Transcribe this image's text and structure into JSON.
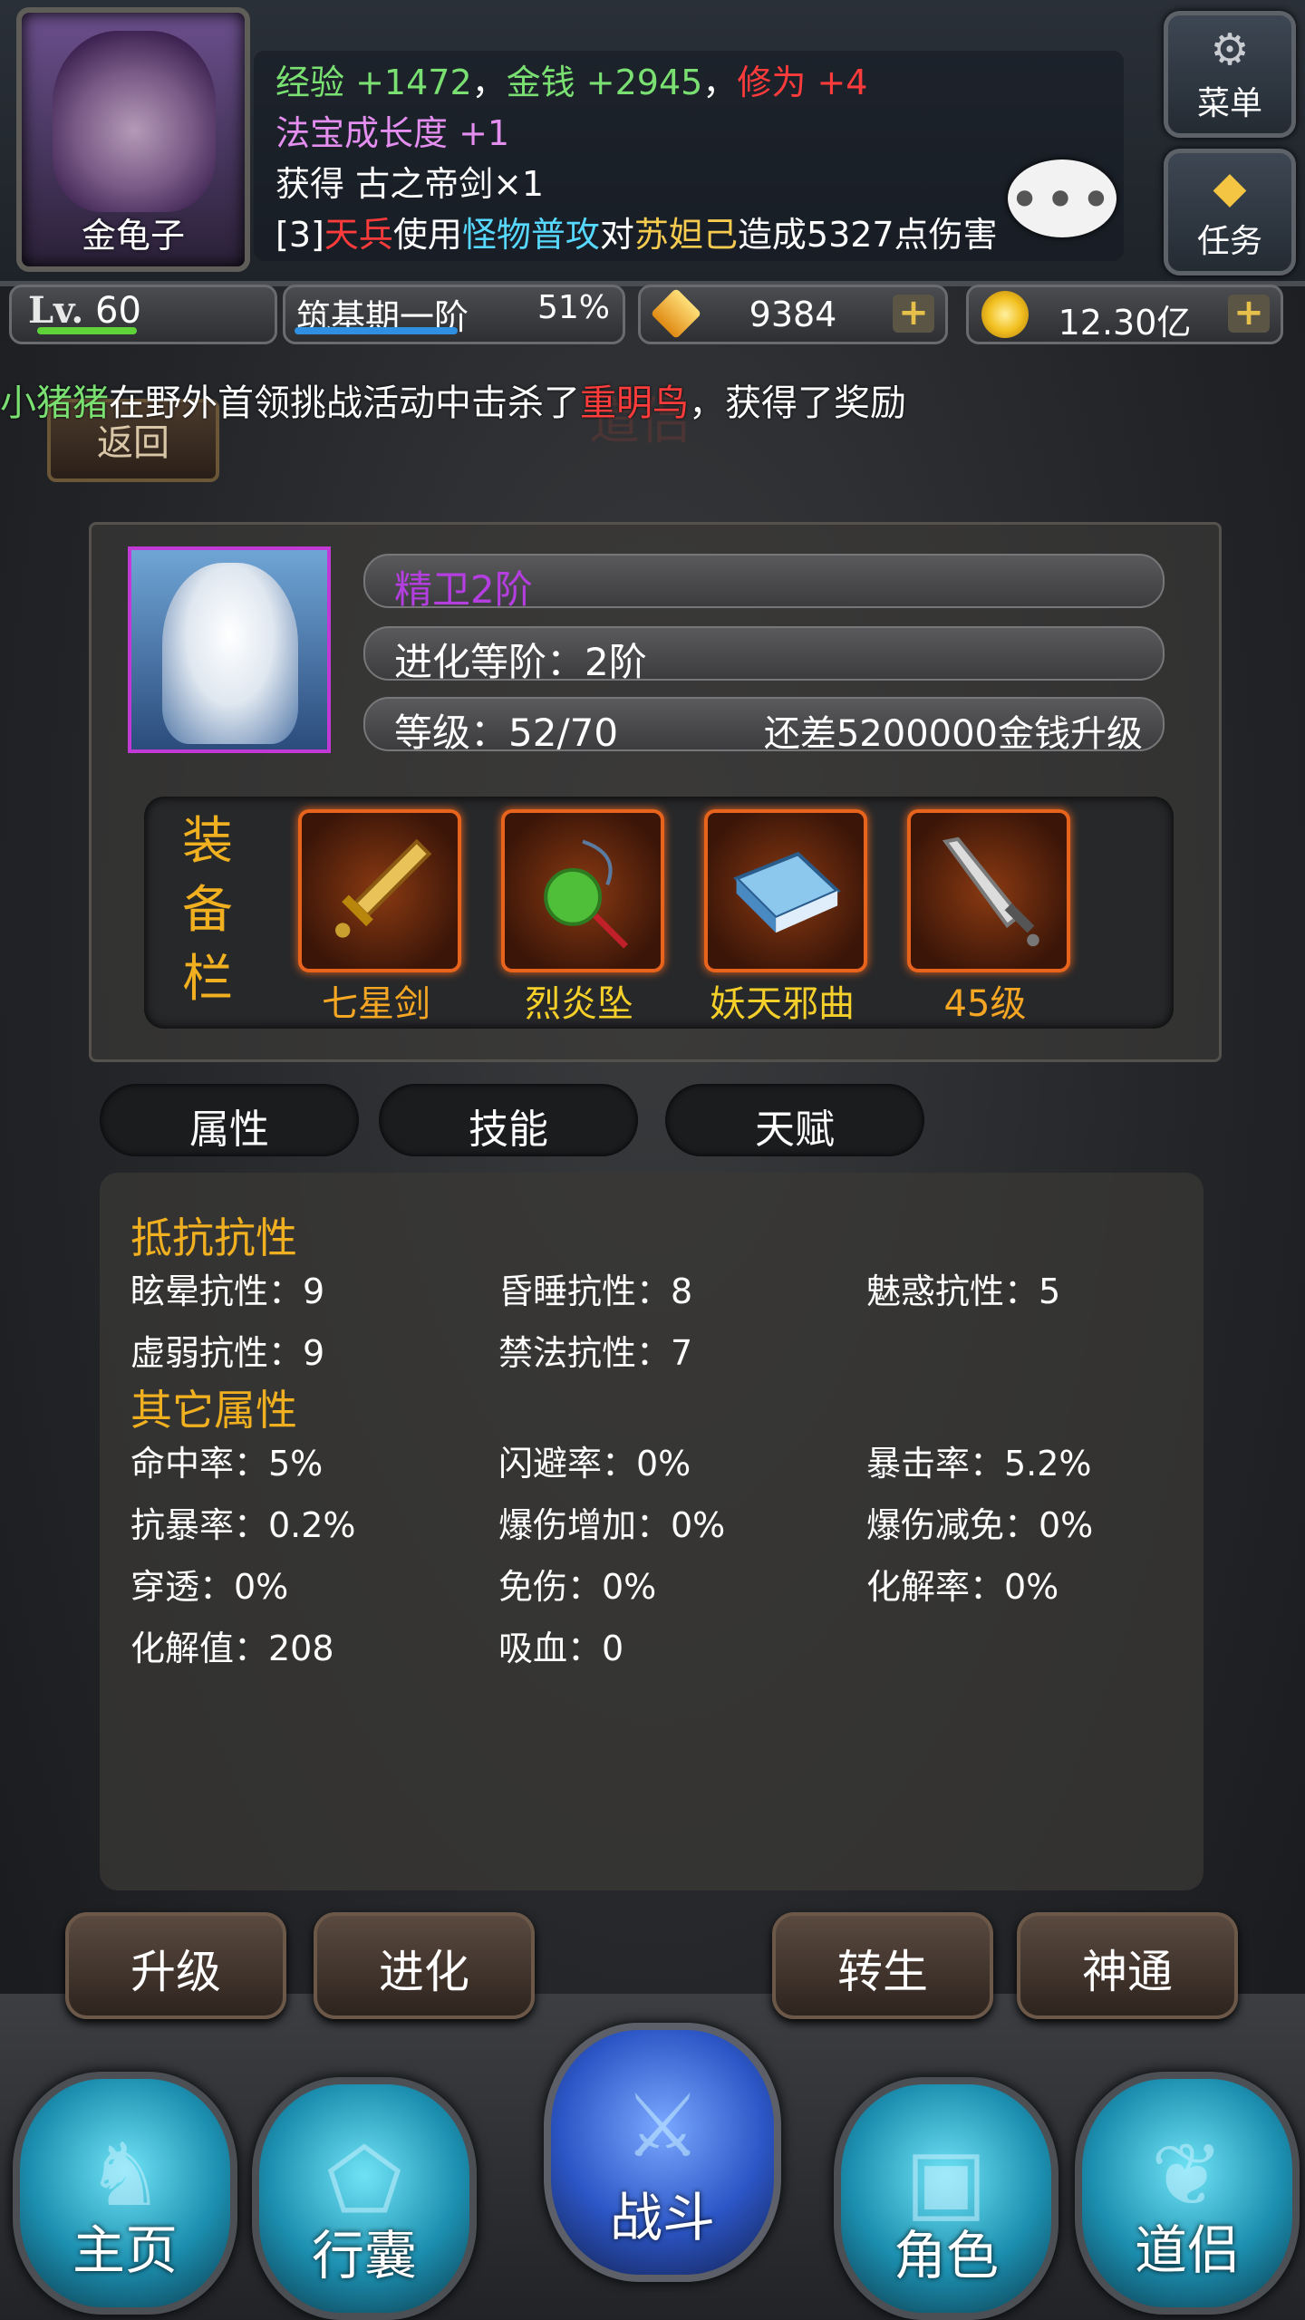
{
  "player": {
    "name": "金龟子",
    "level_label": "Lv.",
    "level": "60",
    "stage": "筑基期一阶",
    "stage_progress": "51%"
  },
  "combat_log": {
    "line1": [
      {
        "t": "经验",
        "c": "green"
      },
      {
        "t": " +1472",
        "c": "green"
      },
      {
        "t": "，",
        "c": "white"
      },
      {
        "t": "金钱",
        "c": "green"
      },
      {
        "t": " +2945",
        "c": "green"
      },
      {
        "t": "，",
        "c": "white"
      },
      {
        "t": "修为",
        "c": "red"
      },
      {
        "t": " +4",
        "c": "red"
      }
    ],
    "line2": [
      {
        "t": "法宝成长度",
        "c": "pink"
      },
      {
        "t": " +1",
        "c": "pink"
      }
    ],
    "line3": [
      {
        "t": "获得 古之帝剑×1",
        "c": "white"
      }
    ],
    "line4": [
      {
        "t": "[3]",
        "c": "white"
      },
      {
        "t": "天兵",
        "c": "red"
      },
      {
        "t": "使用",
        "c": "white"
      },
      {
        "t": "怪物普攻",
        "c": "cyan"
      },
      {
        "t": "对",
        "c": "white"
      },
      {
        "t": "苏妲己",
        "c": "gold"
      },
      {
        "t": "造成5327点伤害",
        "c": "white"
      }
    ]
  },
  "menu": {
    "menu_label": "菜单",
    "task_label": "任务"
  },
  "currency": {
    "diamonds": "9384",
    "gold": "12.30亿",
    "plus": "+"
  },
  "announcement": [
    {
      "t": "小猪猪",
      "c": "green"
    },
    {
      "t": "在野外首领挑战活动中击杀了",
      "c": "white"
    },
    {
      "t": "重明鸟",
      "c": "red"
    },
    {
      "t": "，获得了奖励",
      "c": "white"
    }
  ],
  "back_label": "返回",
  "ghost_title": "道侣",
  "companion": {
    "name": "精卫2阶",
    "evolve_stage": "进化等阶：2阶",
    "level": "等级：52/70",
    "upgrade_hint": "还差5200000金钱升级"
  },
  "equipment": {
    "label": "装备栏",
    "slots": [
      {
        "name": "七星剑",
        "color": "#f5a623"
      },
      {
        "name": "烈炎坠",
        "color": "#f6d02a"
      },
      {
        "name": "妖天邪曲",
        "color": "#f6d02a"
      },
      {
        "name": "45级",
        "color": "#f5a623"
      }
    ]
  },
  "tabs": [
    "属性",
    "技能",
    "天赋"
  ],
  "attributes": {
    "resist_title": "抵抗抗性",
    "resist": [
      [
        "眩晕抗性：9",
        "昏睡抗性：8",
        "魅惑抗性：5"
      ],
      [
        "虚弱抗性：9",
        "禁法抗性：7",
        ""
      ]
    ],
    "other_title": "其它属性",
    "other": [
      [
        "命中率：5%",
        "闪避率：0%",
        "暴击率：5.2%"
      ],
      [
        "抗暴率：0.2%",
        "爆伤增加：0%",
        "爆伤减免：0%"
      ],
      [
        "穿透：0%",
        "免伤：0%",
        "化解率：0%"
      ],
      [
        "化解值：208",
        "吸血：0",
        ""
      ]
    ]
  },
  "actions": [
    "升级",
    "进化",
    "转生",
    "神通"
  ],
  "nav": [
    "主页",
    "行囊",
    "战斗",
    "角色",
    "道侣"
  ],
  "colors": {
    "green": "#7ae072",
    "red": "#ff3b3b",
    "pink": "#e48ef0",
    "cyan": "#57d8ff",
    "gold": "#f6cb50",
    "section_gold": "#f0b020",
    "exp_bar": "#5fd23a",
    "stage_bar": "#2f8fe0",
    "portrait_border": "#c23ad6"
  },
  "icons": {
    "menu": "gear-icon",
    "task": "diamond-icon",
    "chat": "chat-bubble-icon",
    "diamond": "diamond-icon",
    "gold": "gold-coin-icon"
  }
}
